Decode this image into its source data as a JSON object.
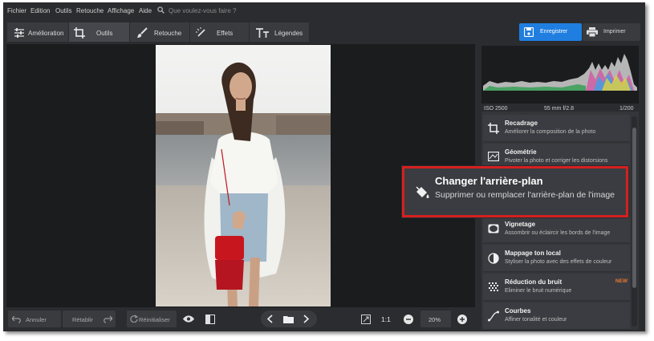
{
  "menu": {
    "items": [
      "Fichier",
      "Edition",
      "Outils",
      "Retouche",
      "Affichage",
      "Aide"
    ],
    "search_placeholder": "Que voulez-vous faire ?"
  },
  "tabs": [
    {
      "label": "Amélioration",
      "icon": "sliders-icon"
    },
    {
      "label": "Outils",
      "icon": "crop-icon",
      "active": true
    },
    {
      "label": "Retouche",
      "icon": "brush-icon"
    },
    {
      "label": "Effets",
      "icon": "magic-wand-icon"
    },
    {
      "label": "Légendes",
      "icon": "text-icon"
    }
  ],
  "actions": {
    "save": "Enregistrer",
    "print": "Imprimer"
  },
  "histogram": {
    "iso": "ISO 2500",
    "lens": "55 mm f/2.8",
    "shutter": "1/200"
  },
  "tools": [
    {
      "title": "Recadrage",
      "desc": "Améliorer la composition de la photo",
      "icon": "crop-icon"
    },
    {
      "title": "Géométrie",
      "desc": "Pivoter la photo et corriger les distorsions",
      "icon": "geometry-icon"
    },
    {
      "title": "Vignetage",
      "desc": "Assombrir ou éclaircir les bords de l'image",
      "icon": "vignette-icon"
    },
    {
      "title": "Mappage ton local",
      "desc": "Styliser la photo avec des effets de couleur",
      "icon": "tone-icon"
    },
    {
      "title": "Réduction du bruit",
      "desc": "Eliminer le bruit numérique",
      "icon": "noise-icon",
      "badge": "NEW"
    },
    {
      "title": "Courbes",
      "desc": "Affiner tonalité et couleur",
      "icon": "curves-icon"
    }
  ],
  "callout": {
    "title": "Changer l'arrière-plan",
    "desc": "Supprimer ou remplacer l'arrière-plan de l'image",
    "icon": "paint-bucket-icon"
  },
  "bottom": {
    "undo": "Annuler",
    "redo": "Rétablir",
    "reset": "Réinitialiser",
    "ratio": "1:1",
    "zoom": "20%"
  },
  "colors": {
    "accent": "#1f7ee0",
    "highlight": "#d6201f",
    "new_badge": "#e8772e",
    "panel": "#2b2c2f"
  }
}
